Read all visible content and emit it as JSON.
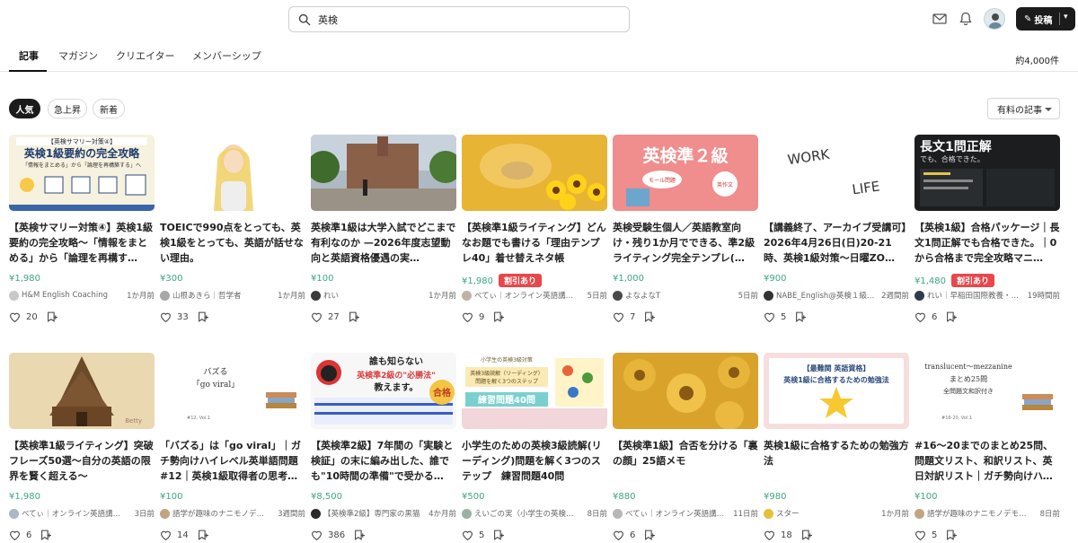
{
  "search": {
    "value": "英検"
  },
  "header": {
    "post_label": "投稿"
  },
  "tabs": [
    {
      "label": "記事"
    },
    {
      "label": "マガジン"
    },
    {
      "label": "クリエイター"
    },
    {
      "label": "メンバーシップ"
    }
  ],
  "result_count": "約4,000件",
  "filters": [
    {
      "label": "人気"
    },
    {
      "label": "急上昇"
    },
    {
      "label": "新着"
    }
  ],
  "dropdown": {
    "selected": "有料の記事"
  },
  "icons": {
    "search": "search-icon",
    "mail": "mail-icon",
    "bell": "bell-icon",
    "pencil": "pencil-icon",
    "heart": "heart-icon",
    "magazine": "add-to-magazine-icon"
  },
  "colors": {
    "price": "#3da683",
    "sale": "#e8474b",
    "accent": "#1b1b1b"
  },
  "articles": [
    {
      "thumb_lines": [
        "【英検サマリー対策④】",
        "英検1級要約の完全攻略",
        "「情報をまとめる」から「論理を再構築する」へ"
      ],
      "title": "【英検サマリー対策④】英検1級要約の完全攻略〜「情報をまとめる」から「論理を再構す…",
      "price": "¥1,980",
      "sale": "",
      "author": "H&M English Coaching",
      "time": "1か月前",
      "likes": "20"
    },
    {
      "thumb_lines": [],
      "title": "TOEICで990点をとっても、英検1級をとっても、英語が話せない理由。",
      "price": "¥300",
      "sale": "",
      "author": "山根あきら｜哲学者",
      "time": "1か月前",
      "likes": "33"
    },
    {
      "thumb_lines": [],
      "title": "英検準1級は大学入試でどこまで有利なのか —2026年度志望動向と英語資格優遇の実…",
      "price": "¥100",
      "sale": "",
      "author": "れい",
      "time": "1か月前",
      "likes": "27"
    },
    {
      "thumb_lines": [],
      "title": "【英検準1級ライティング】どんなお題でも書ける「理由テンプレ40」着せ替えネタ帳",
      "price": "¥1,980",
      "sale": "割引あり",
      "author": "べてぃ｜オンライン英語講…",
      "time": "5日前",
      "likes": "9"
    },
    {
      "thumb_lines": [
        "英検準２級",
        "モール問題",
        "英作文"
      ],
      "title": "英検受験生個人／英語教室向け・残り1か月でできる、準2級ライティング完全テンプレ(…",
      "price": "¥1,000",
      "sale": "",
      "author": "よなよなT",
      "time": "5日前",
      "likes": "7"
    },
    {
      "thumb_lines": [
        "WORK",
        "LIFE"
      ],
      "title": "【講義終了、アーカイブ受講可】2026年4月26日(日)20-21時、英検1級対策〜日曜ZO…",
      "price": "¥900",
      "sale": "",
      "author": "NABE_English@英検１級…",
      "time": "2週間前",
      "likes": "5"
    },
    {
      "thumb_lines": [
        "長文1問正解",
        "でも、合格できた。"
      ],
      "title": "【英検1級】合格パッケージ｜長文1問正解でも合格できた。｜0から合格まで完全攻略マニ…",
      "price": "¥1,480",
      "sale": "割引あり",
      "author": "れい｜早稲田国際教養・…",
      "time": "19時間前",
      "likes": "6"
    },
    {
      "thumb_lines": [
        "Betty"
      ],
      "title": "【英検準1級ライティング】突破フレーズ50選〜自分の英語の限界を賢く超える〜",
      "price": "¥1,980",
      "sale": "",
      "author": "べてぃ｜オンライン英語講…",
      "time": "3日前",
      "likes": "6"
    },
    {
      "thumb_lines": [
        "バズる",
        "「go viral」",
        "#12, Vol.1"
      ],
      "title": "「バズる」は「go viral」｜ガチ勢向けハイレベル英単語問題 #12｜英検1級取得者の思考…",
      "price": "¥100",
      "sale": "",
      "author": "語学が趣味のナニモノデ…",
      "time": "3週間前",
      "likes": "14"
    },
    {
      "thumb_lines": [
        "誰も知らない",
        "英検準2級の\"必勝法\"",
        "教えます。",
        "合格"
      ],
      "title": "【英検準2級】7年間の「実験と検証」の末に編み出した、誰でも\"10時間の準備\"で受かる…",
      "price": "¥8,500",
      "sale": "",
      "author": "【英検準2級】専門家の黒猫",
      "time": "4か月前",
      "likes": "386"
    },
    {
      "thumb_lines": [
        "小学生の英検3級対策",
        "英検3級読解（リーディング）",
        "問題を解く3つのステップ",
        "練習問題40問"
      ],
      "title": "小学生のための英検3級読解(リーディング)問題を解く3つのステップ　練習問題40問",
      "price": "¥500",
      "sale": "",
      "author": "えいごの実（小学生の英検…",
      "time": "8日前",
      "likes": "5"
    },
    {
      "thumb_lines": [],
      "title": "【英検準1級】合否を分ける「裏の顔」25語メモ",
      "price": "¥880",
      "sale": "",
      "author": "べてぃ｜オンライン英語講…",
      "time": "11日前",
      "likes": "6"
    },
    {
      "thumb_lines": [
        "【最難関 英語資格】",
        "英検1級に合格するための勉強法"
      ],
      "title": "英検1級に合格するための勉強方法",
      "price": "¥980",
      "sale": "",
      "author": "スター",
      "time": "1か月前",
      "likes": "18"
    },
    {
      "thumb_lines": [
        "translucent〜mezzanine",
        "まとめ25問",
        "全問題文和訳付き",
        "#16-20, Vol.1"
      ],
      "title": "#16〜20までのまとめ25問、問題文リスト、和訳リスト、英日対訳リスト｜ガチ勢向けハイレ…",
      "price": "¥100",
      "sale": "",
      "author": "語学が趣味のナニモノデモ…",
      "time": "8日前",
      "likes": "5"
    }
  ]
}
